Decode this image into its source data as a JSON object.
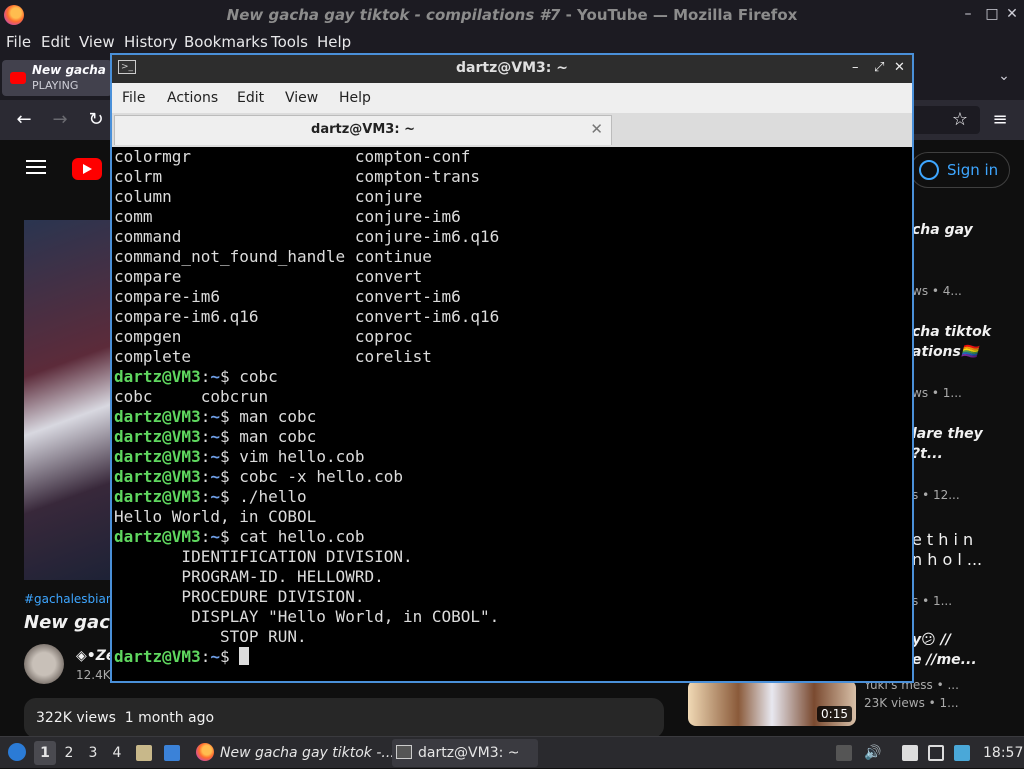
{
  "firefox": {
    "title_italic": "New gacha gay tiktok - compilations #7",
    "title_rest": " - YouTube — Mozilla Firefox",
    "menu": [
      "File",
      "Edit",
      "View",
      "History",
      "Bookmarks",
      "Tools",
      "Help"
    ],
    "tab": {
      "title": "New gacha gay tiktok",
      "status": "PLAYING"
    }
  },
  "youtube": {
    "signin": "Sign in",
    "hashtag": "#gachalesbian #",
    "video_title": "New gach",
    "channel": "◈•Ze",
    "subscribers": "12.4K",
    "views": "322K views",
    "age": "1 month ago",
    "sidebar": [
      {
        "line1": "cha gay",
        "line2": "",
        "meta": "ws • 4..."
      },
      {
        "line1": "cha tiktok",
        "line2": "ations🏳️‍🌈",
        "meta": "ws • 1..."
      },
      {
        "line1": "lare they",
        "line2": "?t...",
        "meta": "s • 12..."
      },
      {
        "line1": "e t h i n",
        "line2": "n h o l ...",
        "meta": "s • 1..."
      },
      {
        "line1": "y😕 //",
        "line2": "e //me...",
        "meta": "Yuki's mess • ..."
      }
    ],
    "last_views": "23K views • 1...",
    "thumb_duration": "0:15"
  },
  "terminal": {
    "window_title": "dartz@VM3: ~",
    "menu": [
      "File",
      "Actions",
      "Edit",
      "View",
      "Help"
    ],
    "tab_title": "dartz@VM3: ~",
    "prompt_user": "dartz@VM3",
    "prompt_path": "~",
    "lines": [
      {
        "text": "colormgr                 compton-conf"
      },
      {
        "text": "colrm                    compton-trans"
      },
      {
        "text": "column                   conjure"
      },
      {
        "text": "comm                     conjure-im6"
      },
      {
        "text": "command                  conjure-im6.q16"
      },
      {
        "text": "command_not_found_handle continue"
      },
      {
        "text": "compare                  convert"
      },
      {
        "text": "compare-im6              convert-im6"
      },
      {
        "text": "compare-im6.q16          convert-im6.q16"
      },
      {
        "text": "compgen                  coproc"
      },
      {
        "text": "complete                 corelist"
      },
      {
        "cmd": " cobc"
      },
      {
        "text": "cobc     cobcrun"
      },
      {
        "cmd": " man cobc"
      },
      {
        "cmd": " man cobc"
      },
      {
        "cmd": " vim hello.cob"
      },
      {
        "cmd": " cobc -x hello.cob"
      },
      {
        "cmd": " ./hello"
      },
      {
        "text": "Hello World, in COBOL"
      },
      {
        "cmd": " cat hello.cob"
      },
      {
        "text": "       IDENTIFICATION DIVISION."
      },
      {
        "text": "       PROGRAM-ID. HELLOWRD."
      },
      {
        "text": "       PROCEDURE DIVISION."
      },
      {
        "text": "        DISPLAY \"Hello World, in COBOL\"."
      },
      {
        "text": "           STOP RUN."
      },
      {
        "cmd": " "
      }
    ]
  },
  "taskbar": {
    "workspaces": [
      "1",
      "2",
      "3",
      "4"
    ],
    "tasks": [
      "New gacha gay tiktok -...",
      "dartz@VM3: ~"
    ],
    "clock": "18:57"
  }
}
